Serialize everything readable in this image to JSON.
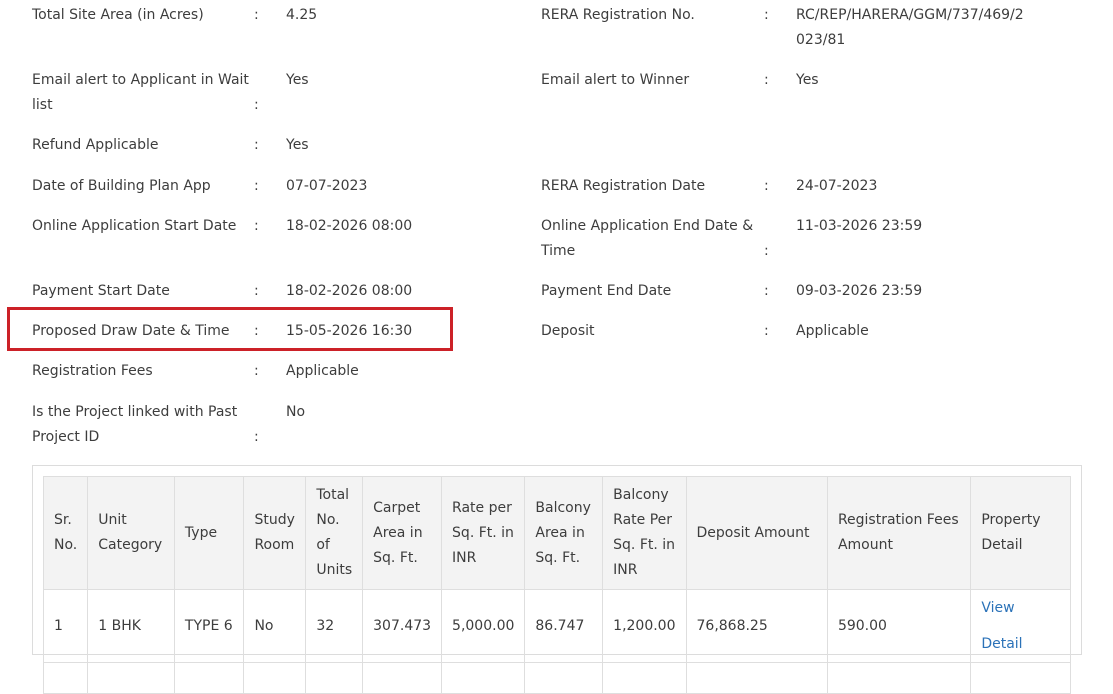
{
  "details": {
    "total_site_area": {
      "label": "Total Site Area (in Acres)",
      "value": "4.25"
    },
    "rera_reg_no": {
      "label": "RERA Registration No.",
      "value": "RC/REP/HARERA/GGM/737/469/2023/81"
    },
    "email_alert_wait": {
      "label": "Email alert to Applicant in Wait list",
      "value": "Yes"
    },
    "email_alert_winner": {
      "label": "Email alert to Winner",
      "value": "Yes"
    },
    "refund": {
      "label": "Refund Applicable",
      "value": "Yes"
    },
    "building_plan_date": {
      "label": "Date of Building Plan App",
      "value": "07-07-2023"
    },
    "rera_reg_date": {
      "label": "RERA Registration Date",
      "value": "24-07-2023"
    },
    "online_start": {
      "label": "Online Application Start Date",
      "value": "18-02-2026 08:00"
    },
    "online_end": {
      "label": "Online Application End Date & Time",
      "value": "11-03-2026 23:59"
    },
    "payment_start": {
      "label": "Payment Start Date",
      "value": "18-02-2026 08:00"
    },
    "payment_end": {
      "label": "Payment End Date",
      "value": "09-03-2026 23:59"
    },
    "draw_date": {
      "label": "Proposed Draw Date & Time",
      "value": "15-05-2026 16:30"
    },
    "deposit": {
      "label": "Deposit",
      "value": "Applicable"
    },
    "registration_fees": {
      "label": "Registration Fees",
      "value": "Applicable"
    },
    "past_project": {
      "label": "Is the Project linked with Past Project ID",
      "value": "No"
    }
  },
  "separator": ":",
  "table": {
    "headers": [
      "Sr. No.",
      "Unit Category",
      "Type",
      "Study Room",
      "Total No. of Units",
      "Carpet Area in Sq. Ft.",
      "Rate per Sq. Ft. in INR",
      "Balcony Area in Sq. Ft.",
      "Balcony Rate Per Sq. Ft. in INR",
      "Deposit Amount",
      "Registration Fees Amount",
      "Property Detail"
    ],
    "rows": [
      [
        "1",
        "1 BHK",
        "TYPE 6",
        "No",
        "32",
        "307.473",
        "5,000.00",
        "86.747",
        "1,200.00",
        "76,868.25",
        "590.00",
        "View Detail"
      ]
    ]
  },
  "colors": {
    "highlight": "#cc2128",
    "link": "#2b72b8",
    "header_bg": "#f3f3f3"
  }
}
